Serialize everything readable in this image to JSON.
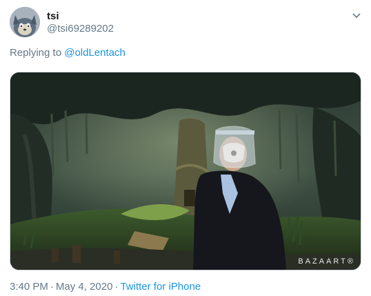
{
  "user": {
    "name": "tsi",
    "handle": "@tsi69289202"
  },
  "reply": {
    "prefix": "Replying to ",
    "mention": "@oldLentach"
  },
  "media": {
    "watermark": "BAZAART®"
  },
  "meta": {
    "time": "3:40 PM",
    "separator": "·",
    "date": "May 4, 2020",
    "source": "Twitter for iPhone"
  },
  "colors": {
    "link": "#1b95e0",
    "secondary": "#657786",
    "primary_text": "#14171a"
  },
  "icons": {
    "caret": "chevron-down-icon"
  }
}
